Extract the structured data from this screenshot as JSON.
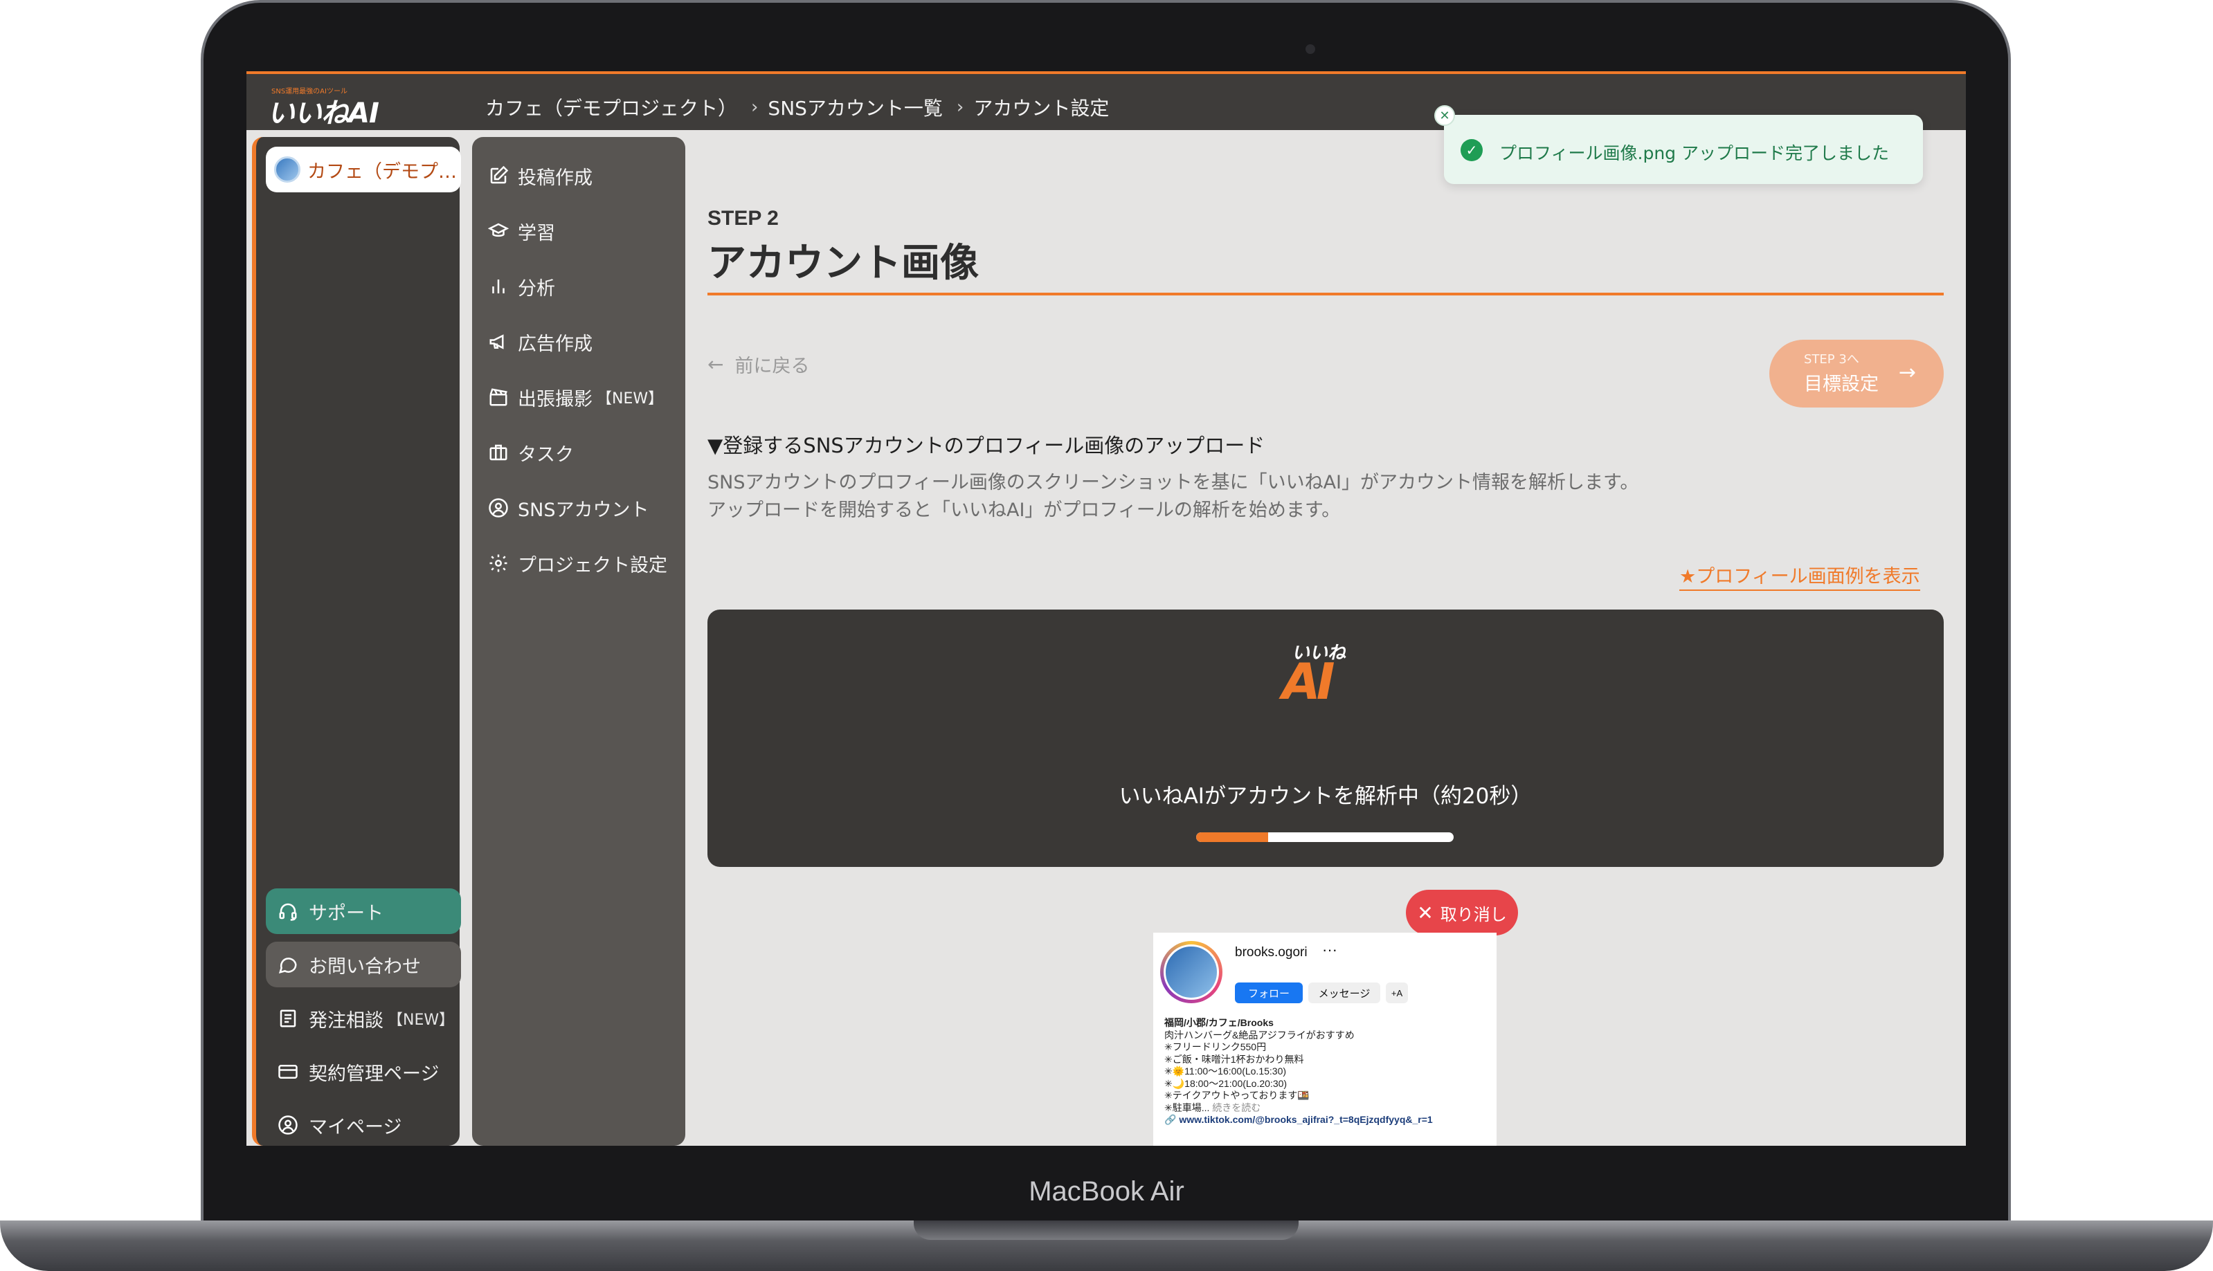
{
  "device": {
    "label": "MacBook Air"
  },
  "app": {
    "logo": {
      "tagline": "SNS運用最強のAIツール",
      "wordmark": "いいねAI"
    },
    "breadcrumb": [
      "カフェ（デモプロジェクト）",
      "SNSアカウント一覧",
      "アカウント設定"
    ]
  },
  "sidebar_left": {
    "project": "カフェ（デモプロジェクト）",
    "support": "サポート",
    "contact": "お問い合わせ",
    "order": {
      "label": "発注相談",
      "tag": "【NEW】"
    },
    "contract": "契約管理ページ",
    "mypage": "マイページ"
  },
  "sidebar_nav": {
    "items": [
      {
        "label": "投稿作成",
        "icon": "edit-icon"
      },
      {
        "label": "学習",
        "icon": "graduation-cap-icon"
      },
      {
        "label": "分析",
        "icon": "bar-chart-icon"
      },
      {
        "label": "広告作成",
        "icon": "megaphone-icon"
      },
      {
        "label": "出張撮影",
        "tag": "【NEW】",
        "icon": "clapperboard-icon"
      },
      {
        "label": "タスク",
        "icon": "briefcase-icon"
      },
      {
        "label": "SNSアカウント",
        "icon": "user-circle-icon"
      },
      {
        "label": "プロジェクト設定",
        "icon": "gear-icon"
      }
    ]
  },
  "main": {
    "step_label": "STEP 2",
    "title": "アカウント画像",
    "back": "前に戻る",
    "next": {
      "small": "STEP 3へ",
      "label": "目標設定"
    },
    "section_heading": "▼登録するSNSアカウントのプロフィール画像のアップロード",
    "description": [
      "SNSアカウントのプロフィール画像のスクリーンショットを基に「いいねAI」がアカウント情報を解析します。",
      "アップロードを開始すると「いいねAI」がプロフィールの解析を始めます。"
    ],
    "example_link": "★プロフィール画面例を表示",
    "analysis": {
      "logo_top": "いいね",
      "logo_bottom": "AI",
      "status": "いいねAIがアカウントを解析中（約20秒）",
      "progress": 0.28
    },
    "cancel": "取り消し"
  },
  "profile_preview": {
    "username": "brooks.ogori",
    "more": "···",
    "follow": "フォロー",
    "message": "メッセージ",
    "add_user": "+A",
    "bio": {
      "name": "福岡/小郡/カフェ/Brooks",
      "lines": [
        "肉汁ハンバーグ&絶品アジフライがおすすめ",
        "✳︎フリードリンク550円",
        "✳︎ご飯・味噌汁1杯おかわり無料",
        "✳︎🌞11:00〜16:00(Lo.15:30)",
        "✳︎🌙18:00〜21:00(Lo.20:30)",
        "✳︎テイクアウトやっております🍱"
      ],
      "parking": "✳︎駐車場...",
      "more": "続きを読む",
      "link": "www.tiktok.com/@brooks_ajifrai?_t=8qEjzqdfyyq&_r=1"
    }
  },
  "toast": {
    "message": "プロフィール画像.png アップロード完了しました"
  },
  "colors": {
    "accent": "#f07a2a",
    "support": "#3b8a78",
    "danger": "#e7454a",
    "success": "#1f9d55"
  }
}
